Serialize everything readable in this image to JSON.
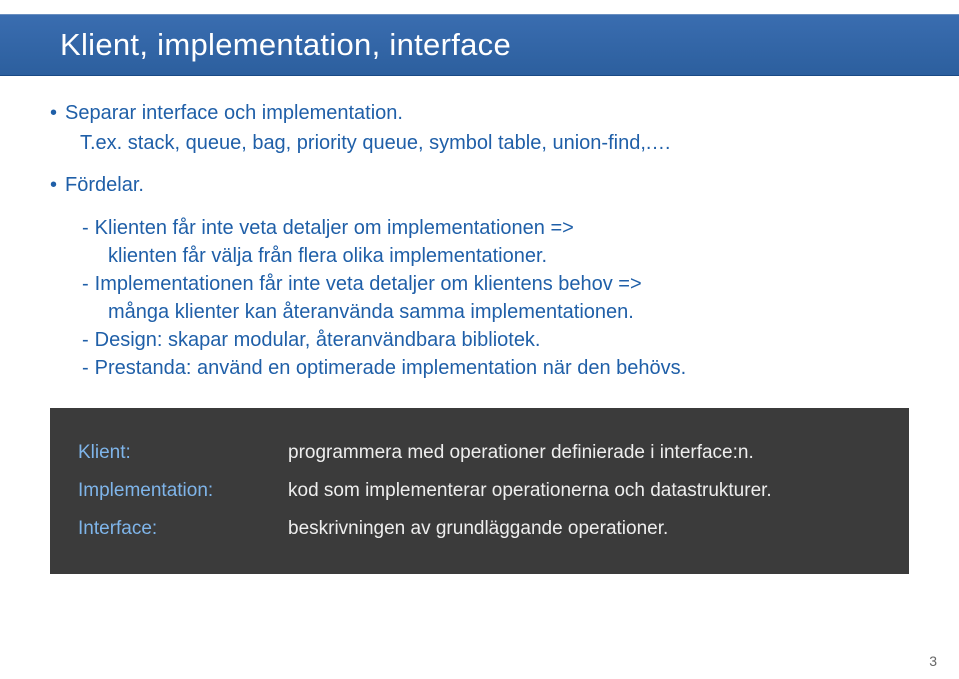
{
  "title": "Klient, implementation, interface",
  "bullets": [
    {
      "head": "Separar interface och implementation.",
      "sub": "T.ex.  stack, queue, bag, priority queue, symbol table, union-find,.…"
    },
    {
      "head": "Fördelar."
    }
  ],
  "dash_items": [
    {
      "first": "Klienten får inte veta detaljer om implementationen =>",
      "cont": "klienten får välja från flera olika implementationer."
    },
    {
      "first": "Implementationen får inte veta detaljer om klientens behov =>",
      "cont": "många klienter kan återanvända samma implementationen."
    },
    {
      "first": "Design:  skapar modular, återanvändbara bibliotek."
    },
    {
      "first": "Prestanda: använd en optimerade implementation när den behövs."
    }
  ],
  "defs": [
    {
      "term": "Klient:",
      "desc": "programmera med operationer definierade i interface:n."
    },
    {
      "term": "Implementation:",
      "desc": "kod som implementerar operationerna och datastrukturer."
    },
    {
      "term": "Interface:",
      "desc": "beskrivningen av grundläggande operationer."
    }
  ],
  "page_number": "3"
}
